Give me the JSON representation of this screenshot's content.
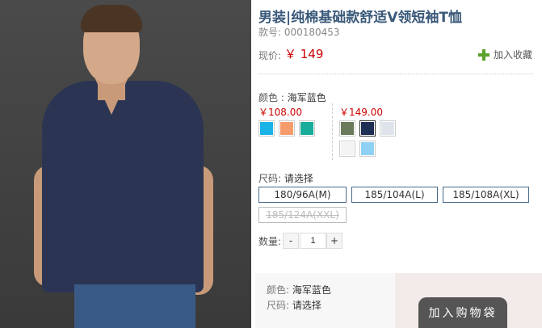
{
  "product": {
    "title": "男装|纯棉基础款舒适V领短袖T恤",
    "sku": "款号: 000180453",
    "price_label": "现价:",
    "price_value": "￥ 149",
    "favorite_label": "加入收藏"
  },
  "color": {
    "label": "颜色 :",
    "selected": "海军蓝色",
    "group1_price": "￥108.00",
    "group2_price": "￥149.00",
    "group1_swatches": [
      {
        "name": "sky-blue",
        "hex": "#1ab3e8"
      },
      {
        "name": "orange",
        "hex": "#f59b6c"
      },
      {
        "name": "teal",
        "hex": "#18ad9a"
      }
    ],
    "group2_swatches": [
      {
        "name": "olive",
        "hex": "#6a7a5a"
      },
      {
        "name": "navy",
        "hex": "#1e2f55"
      },
      {
        "name": "light-gray",
        "hex": "#dfe4ec"
      },
      {
        "name": "white",
        "hex": "#f4f4f4"
      },
      {
        "name": "light-blue",
        "hex": "#8fd0f5"
      }
    ]
  },
  "size": {
    "label": "尺码:",
    "prompt": "请选择",
    "options": [
      "180/96A(M)",
      "185/104A(L)",
      "185/108A(XL)",
      "185/124A(XXL)"
    ]
  },
  "quantity": {
    "label": "数量:",
    "minus": "-",
    "value": "1",
    "plus": "+"
  },
  "summary": {
    "color_label": "颜色:",
    "color_value": "海军蓝色",
    "size_label": "尺码:",
    "size_value": "请选择"
  },
  "cart_button": "加入购物袋"
}
